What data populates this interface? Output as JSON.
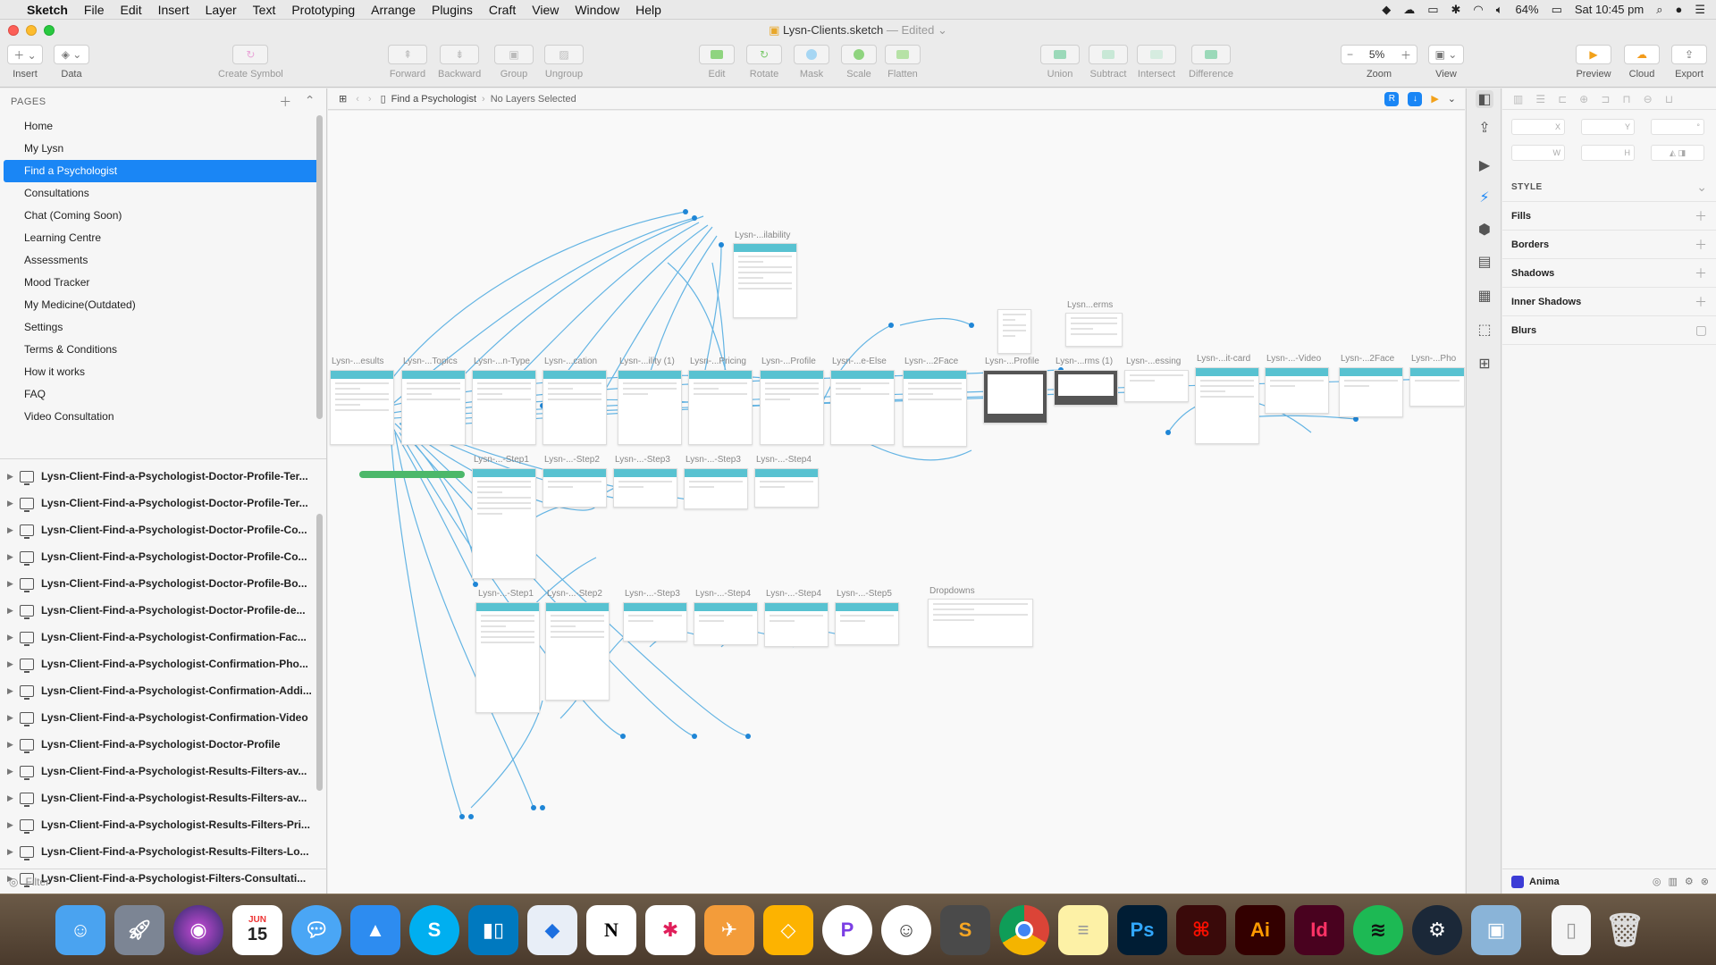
{
  "menubar": {
    "app": "Sketch",
    "items": [
      "File",
      "Edit",
      "Insert",
      "Layer",
      "Text",
      "Prototyping",
      "Arrange",
      "Plugins",
      "Craft",
      "View",
      "Window",
      "Help"
    ],
    "battery": "64%",
    "clock": "Sat 10:45 pm"
  },
  "window": {
    "title": "Lysn-Clients.sketch",
    "edited": "— Edited"
  },
  "toolbar": {
    "insert": "Insert",
    "data": "Data",
    "create_symbol": "Create Symbol",
    "forward": "Forward",
    "backward": "Backward",
    "group": "Group",
    "ungroup": "Ungroup",
    "edit": "Edit",
    "rotate": "Rotate",
    "mask": "Mask",
    "scale": "Scale",
    "flatten": "Flatten",
    "union": "Union",
    "subtract": "Subtract",
    "intersect": "Intersect",
    "difference": "Difference",
    "zoom": "Zoom",
    "zoom_value": "5%",
    "view": "View",
    "preview": "Preview",
    "cloud": "Cloud",
    "export": "Export"
  },
  "sidebar": {
    "pages_header": "PAGES",
    "pages": [
      "Home",
      "My Lysn",
      "Find a Psychologist",
      "Consultations",
      "Chat (Coming Soon)",
      "Learning Centre",
      "Assessments",
      "Mood Tracker",
      "My Medicine(Outdated)",
      "Settings",
      "Terms & Conditions",
      "How it works",
      "FAQ",
      "Video Consultation"
    ],
    "selected_page": "Find a Psychologist",
    "artboards": [
      "Lysn-Client-Find-a-Psychologist-Doctor-Profile-Ter...",
      "Lysn-Client-Find-a-Psychologist-Doctor-Profile-Ter...",
      "Lysn-Client-Find-a-Psychologist-Doctor-Profile-Co...",
      "Lysn-Client-Find-a-Psychologist-Doctor-Profile-Co...",
      "Lysn-Client-Find-a-Psychologist-Doctor-Profile-Bo...",
      "Lysn-Client-Find-a-Psychologist-Doctor-Profile-de...",
      "Lysn-Client-Find-a-Psychologist-Confirmation-Fac...",
      "Lysn-Client-Find-a-Psychologist-Confirmation-Pho...",
      "Lysn-Client-Find-a-Psychologist-Confirmation-Addi...",
      "Lysn-Client-Find-a-Psychologist-Confirmation-Video",
      "Lysn-Client-Find-a-Psychologist-Doctor-Profile",
      "Lysn-Client-Find-a-Psychologist-Results-Filters-av...",
      "Lysn-Client-Find-a-Psychologist-Results-Filters-av...",
      "Lysn-Client-Find-a-Psychologist-Results-Filters-Pri...",
      "Lysn-Client-Find-a-Psychologist-Results-Filters-Lo...",
      "Lysn-Client-Find-a-Psychologist-Filters-Consultati..."
    ],
    "filter_placeholder": "Filter"
  },
  "canvasbar": {
    "breadcrumb": "Find a Psychologist",
    "selection": "No Layers Selected"
  },
  "canvas": {
    "artboard_titles": {
      "a0": "Lysn-...ilability",
      "r1": [
        "Lysn-...esults",
        "Lysn-...Topics",
        "Lysn-...n-Type",
        "Lysn-...cation",
        "Lysn-...ility (1)",
        "Lysn-...Pricing",
        "Lysn-...Profile",
        "Lysn-...e-Else",
        "Lysn-...2Face",
        "Lysn-...Profile",
        "Lysn-...rms (1)",
        "Lysn-...essing",
        "Lysn-...it-card",
        "Lysn-...-Video",
        "Lysn-...2Face",
        "Lysn-...Pho"
      ],
      "terms": "Lysn...erms",
      "r2": [
        "Lysn-...-Step1",
        "Lysn-...-Step2",
        "Lysn-...-Step3",
        "Lysn-...-Step3",
        "Lysn-...-Step4"
      ],
      "r3": [
        "Lysn-...-Step1",
        "Lysn-...-Step2",
        "Lysn-...-Step3",
        "Lysn-...-Step4",
        "Lysn-...-Step4",
        "Lysn-...-Step5"
      ],
      "dropdowns": "Dropdowns"
    },
    "link_color": "#4aa8e0"
  },
  "inspector": {
    "fields": {
      "x": "X",
      "y": "Y",
      "w": "W",
      "h": "H"
    },
    "style": "STYLE",
    "sections": [
      "Fills",
      "Borders",
      "Shadows",
      "Inner Shadows",
      "Blurs"
    ],
    "plugin": "Anima"
  },
  "dock": [
    "finder-icon",
    "launchpad-icon",
    "siri-icon",
    "calendar-icon",
    "messages-icon",
    "testflight-icon",
    "skype-icon",
    "trello-icon",
    "xcode-icon",
    "notion-icon",
    "slack-icon",
    "airmail-icon",
    "sketch-icon",
    "pockity-icon",
    "smiley-icon",
    "sublime-icon",
    "chrome-icon",
    "notes-icon",
    "photoshop-icon",
    "acrobat-icon",
    "illustrator-icon",
    "indesign-icon",
    "spotify-icon",
    "steam-icon",
    "preview-icon",
    "file-icon",
    "trash-icon"
  ],
  "dock_labels": {
    "calendar_month": "JUN",
    "calendar_day": "15",
    "photoshop": "Ps",
    "illustrator": "Ai",
    "indesign": "Id"
  }
}
